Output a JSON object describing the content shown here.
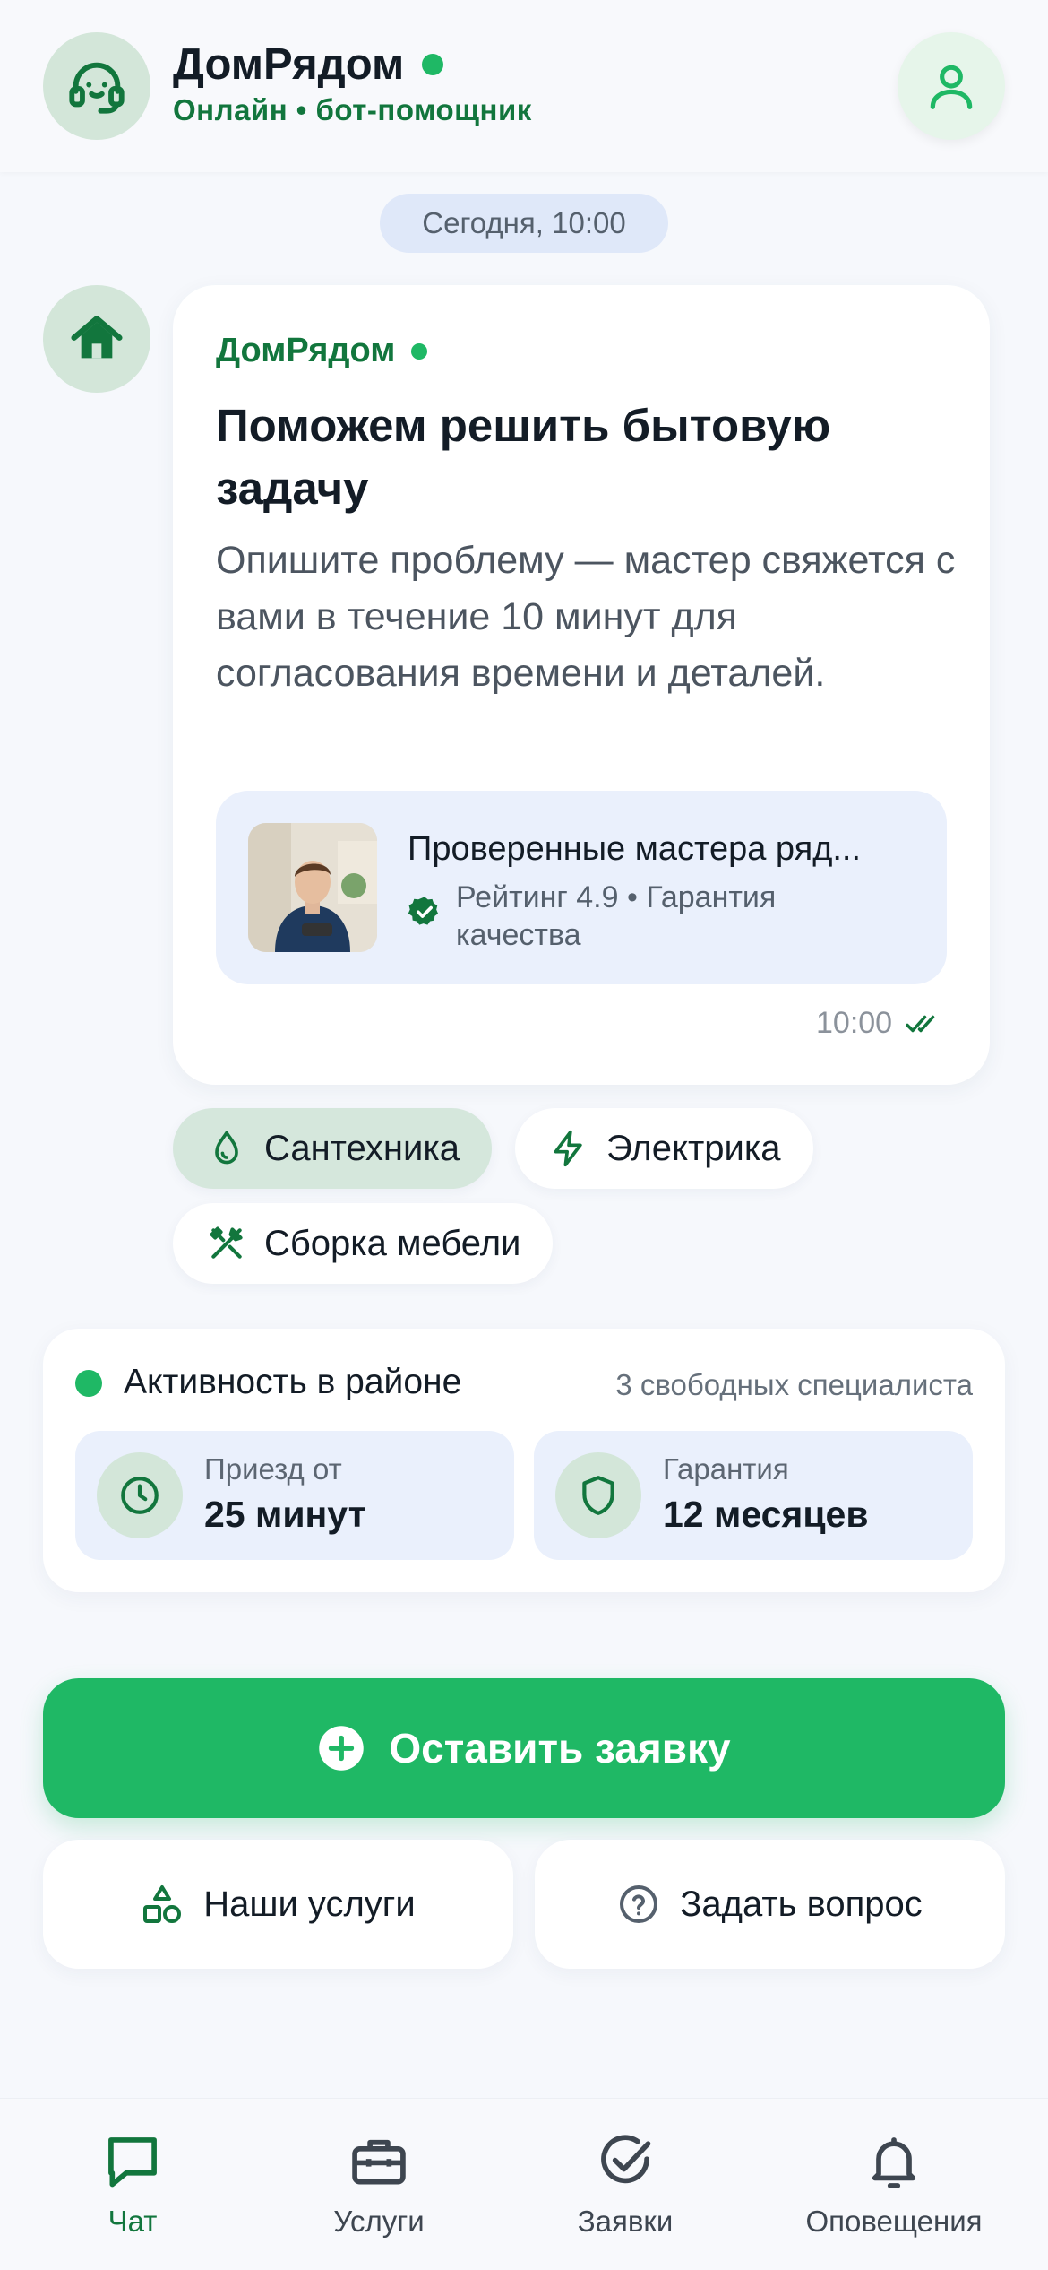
{
  "header": {
    "title": "ДомРядом",
    "subtitle": "Онлайн • бот-помощник",
    "avatar_icon": "headset-icon",
    "profile_icon": "user-icon"
  },
  "date_separator": "Сегодня, 10:00",
  "message": {
    "sender": "ДомРядом",
    "heading": "Поможем решить бытовую задачу",
    "body": "Опишите проблему — мастер свяжется с вами в течение 10 минут для согласования времени и деталей.",
    "promo": {
      "title": "Проверенные мастера ряд...",
      "subtitle": "Рейтинг 4.9 • Гарантия качества"
    },
    "time": "10:00"
  },
  "chips": [
    {
      "label": "Сантехника",
      "icon": "drop-icon",
      "active": true
    },
    {
      "label": "Электрика",
      "icon": "lightning-icon",
      "active": false
    },
    {
      "label": "Сборка мебели",
      "icon": "tools-icon",
      "active": false
    }
  ],
  "activity": {
    "title": "Активность в районе",
    "free": "3 свободных специалиста",
    "stats": [
      {
        "label": "Приезд от",
        "value": "25 минут",
        "icon": "clock-icon"
      },
      {
        "label": "Гарантия",
        "value": "12 месяцев",
        "icon": "shield-icon"
      }
    ]
  },
  "cta": {
    "label": "Оставить заявку"
  },
  "secondary": {
    "services": "Наши услуги",
    "ask": "Задать вопрос"
  },
  "nav": [
    {
      "label": "Чат",
      "icon": "chat-icon",
      "active": true
    },
    {
      "label": "Услуги",
      "icon": "briefcase-icon",
      "active": false
    },
    {
      "label": "Заявки",
      "icon": "check-circle-icon",
      "active": false
    },
    {
      "label": "Оповещения",
      "icon": "bell-icon",
      "active": false
    }
  ],
  "colors": {
    "accent": "#1fb865",
    "accent_dark": "#12763d",
    "soft_green": "#d3e6d9",
    "soft_blue": "#eaf0fc"
  }
}
